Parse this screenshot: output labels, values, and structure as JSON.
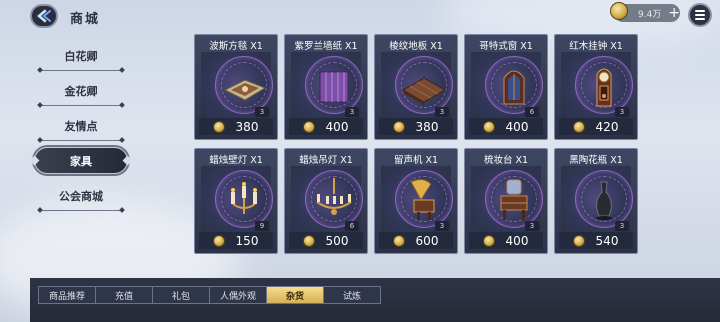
{
  "header": {
    "title": "商城",
    "currency_amount": "9.4万"
  },
  "sidebar": {
    "items": [
      {
        "label": "白花卿"
      },
      {
        "label": "金花卿"
      },
      {
        "label": "友情点"
      },
      {
        "label": "家具",
        "active": true
      },
      {
        "label": "公会商城"
      }
    ]
  },
  "items": [
    {
      "name": "波斯方毯 X1",
      "count": "3",
      "price": "380",
      "icon": "rug-icon"
    },
    {
      "name": "紫罗兰墙纸 X1",
      "count": "3",
      "price": "400",
      "icon": "wallpaper-icon"
    },
    {
      "name": "棱纹地板 X1",
      "count": "3",
      "price": "380",
      "icon": "floor-icon"
    },
    {
      "name": "哥特式窗 X1",
      "count": "6",
      "price": "400",
      "icon": "gothic-window-icon"
    },
    {
      "name": "红木挂钟 X1",
      "count": "3",
      "price": "420",
      "icon": "wall-clock-icon"
    },
    {
      "name": "蜡烛壁灯 X1",
      "count": "9",
      "price": "150",
      "icon": "candle-sconce-icon"
    },
    {
      "name": "蜡烛吊灯 X1",
      "count": "6",
      "price": "500",
      "icon": "chandelier-icon"
    },
    {
      "name": "留声机 X1",
      "count": "3",
      "price": "600",
      "icon": "gramophone-icon"
    },
    {
      "name": "梳妆台 X1",
      "count": "3",
      "price": "400",
      "icon": "dresser-icon"
    },
    {
      "name": "黑陶花瓶 X1",
      "count": "3",
      "price": "540",
      "icon": "vase-icon"
    }
  ],
  "tabs": [
    {
      "label": "商品推荐"
    },
    {
      "label": "充值"
    },
    {
      "label": "礼包"
    },
    {
      "label": "人偶外观"
    },
    {
      "label": "杂货",
      "active": true
    },
    {
      "label": "试炼"
    }
  ],
  "colors": {
    "accent_gold": "#d6b156",
    "card_bg": "#343b54",
    "glow_purple": "#a878dc"
  }
}
